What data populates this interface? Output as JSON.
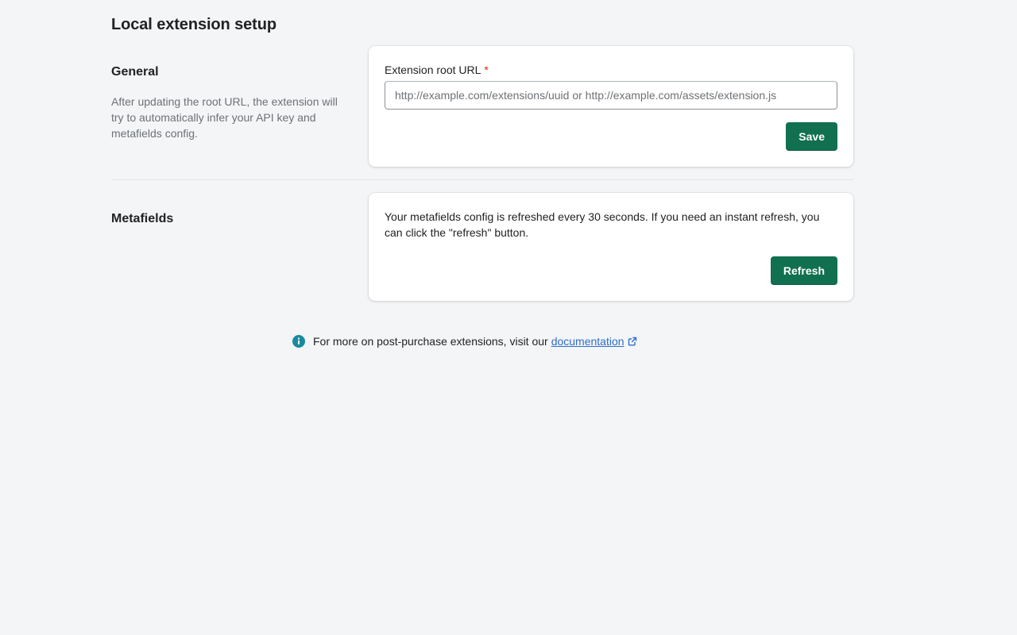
{
  "page": {
    "title": "Local extension setup"
  },
  "general": {
    "heading": "General",
    "description": "After updating the root URL, the extension will try to automatically infer your API key and metafields config.",
    "field_label": "Extension root URL",
    "required_marker": "*",
    "input_value": "",
    "input_placeholder": "http://example.com/extensions/uuid or http://example.com/assets/extension.js",
    "save_label": "Save"
  },
  "metafields": {
    "heading": "Metafields",
    "body": "Your metafields config is refreshed every 30 seconds. If you need an instant refresh, you can click the \"refresh\" button.",
    "refresh_label": "Refresh"
  },
  "footer": {
    "text": "For more on post-purchase extensions, visit our",
    "link_label": "documentation"
  },
  "icons": {
    "info": "info-circle-icon",
    "external": "external-link-icon"
  },
  "colors": {
    "primary_button": "#11704f",
    "link": "#2c6ecb",
    "info": "#1a8a9e",
    "required": "#d72c0d"
  }
}
